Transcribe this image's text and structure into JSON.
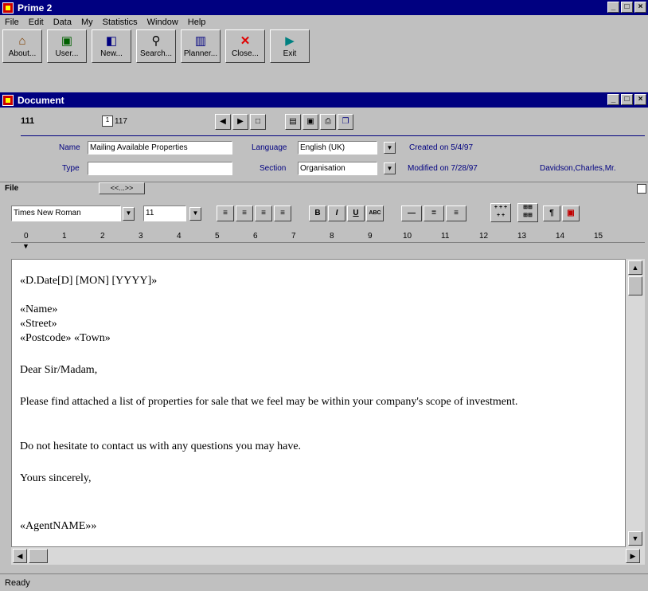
{
  "app": {
    "title": "Prime 2"
  },
  "menu": [
    "File",
    "Edit",
    "Data",
    "My",
    "Statistics",
    "Window",
    "Help"
  ],
  "toolbar": [
    {
      "label": "About...",
      "icon": "about-icon"
    },
    {
      "label": "User...",
      "icon": "user-icon"
    },
    {
      "label": "New...",
      "icon": "new-icon"
    },
    {
      "label": "Search...",
      "icon": "search-icon"
    },
    {
      "label": "Planner...",
      "icon": "planner-icon"
    },
    {
      "label": "Close...",
      "icon": "close-icon"
    },
    {
      "label": "Exit",
      "icon": "exit-icon"
    }
  ],
  "document": {
    "title": "Document",
    "record_id": "111",
    "record_no": "117",
    "name_label": "Name",
    "name_value": "Mailing Available Properties",
    "type_label": "Type",
    "type_value": "",
    "language_label": "Language",
    "language_value": "English (UK)",
    "section_label": "Section",
    "section_value": "Organisation",
    "created": "Created on 5/4/97",
    "modified": "Modified on 7/28/97",
    "author": "Davidson,Charles,Mr."
  },
  "file_bar": {
    "label": "File",
    "btn": "<<...>>"
  },
  "format": {
    "font": "Times New Roman",
    "size": "11"
  },
  "ruler": [
    "0",
    "1",
    "2",
    "3",
    "4",
    "5",
    "6",
    "7",
    "8",
    "9",
    "10",
    "11",
    "12",
    "13",
    "14",
    "15"
  ],
  "body": [
    "«D.Date[D] [MON] [YYYY]»",
    "«Name»",
    "«Street»",
    "«Postcode» «Town»",
    "Dear Sir/Madam,",
    "Please find attached a list of properties for sale that we feel may be within your company's scope of investment.",
    "Do not hesitate to contact us with any questions you may have.",
    "Yours sincerely,",
    "«AgentNAME»»"
  ],
  "status": "Ready"
}
